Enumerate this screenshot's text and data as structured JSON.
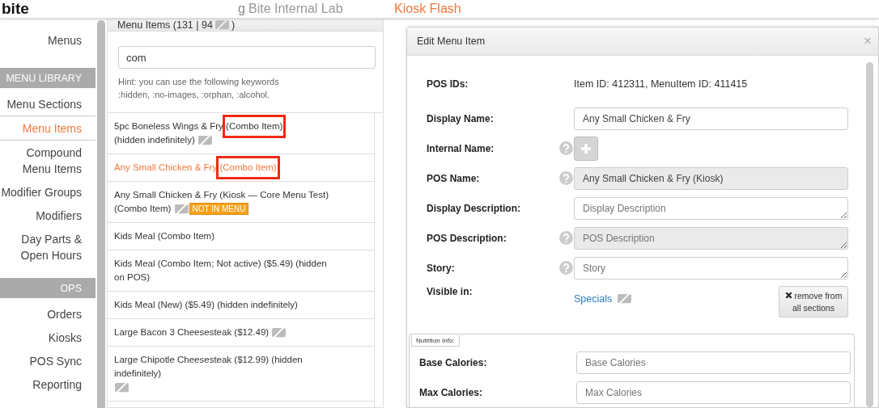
{
  "header": {
    "logo": "bite",
    "nav": [
      "g",
      "Bite Internal Lab",
      "Kiosk Flash"
    ]
  },
  "sidebar": {
    "items": [
      {
        "kind": "link",
        "label": "Menus",
        "selected": false
      },
      {
        "kind": "heading",
        "label": "MENU LIBRARY"
      },
      {
        "kind": "link",
        "label": "Menu Sections",
        "selected": false
      },
      {
        "kind": "link",
        "label": "Menu Items",
        "selected": true
      },
      {
        "kind": "link",
        "label": "Compound Menu Items",
        "selected": false
      },
      {
        "kind": "link",
        "label": "Modifier Groups",
        "selected": false
      },
      {
        "kind": "link",
        "label": "Modifiers",
        "selected": false
      },
      {
        "kind": "link",
        "label": "Day Parts & Open Hours",
        "selected": false
      },
      {
        "kind": "heading",
        "label": "OPS"
      },
      {
        "kind": "link",
        "label": "Orders",
        "selected": false
      },
      {
        "kind": "link",
        "label": "Kiosks",
        "selected": false
      },
      {
        "kind": "link",
        "label": "POS Sync",
        "selected": false
      },
      {
        "kind": "link",
        "label": "Reporting",
        "selected": false
      }
    ]
  },
  "list_panel": {
    "title_start": "Menu Items (131 | 94",
    "title_end": ")",
    "search": {
      "value": "com"
    },
    "hint": "Hint: you can use the following keywords :hidden, :no-images, :orphan, :alcohol.",
    "items": [
      {
        "selected": false,
        "parts": [
          {
            "text": "5pc Boneless Wings & Fry",
            "highlighted": false
          },
          {
            "text": "(Combo Item)",
            "highlighted": true
          },
          {
            "text": "(hidden indefinitely)",
            "highlighted": false
          }
        ],
        "hidden_icon": true
      },
      {
        "selected": true,
        "parts": [
          {
            "text": "Any Small Chicken & Fry",
            "highlighted": false
          },
          {
            "text": "(Combo Item)",
            "highlighted": true
          }
        ],
        "hidden_icon": false
      },
      {
        "selected": false,
        "parts": [
          {
            "text": "Any Small Chicken & Fry (Kiosk — Core Menu Test)",
            "highlighted": false
          },
          {
            "text": "(Combo Item)",
            "highlighted": false
          }
        ],
        "hidden_icon": true,
        "badge": "NOT IN MENU"
      },
      {
        "selected": false,
        "parts": [
          {
            "text": "Kids Meal (Combo Item)",
            "highlighted": false
          }
        ],
        "hidden_icon": false
      },
      {
        "selected": false,
        "parts": [
          {
            "text": "Kids Meal (Combo Item; Not active) ($5.49) (hidden on POS)",
            "highlighted": false
          }
        ],
        "hidden_icon": false
      },
      {
        "selected": false,
        "parts": [
          {
            "text": "Kids Meal (New) ($5.49) (hidden indefinitely)",
            "highlighted": false
          }
        ],
        "hidden_icon": false
      },
      {
        "selected": false,
        "parts": [
          {
            "text": "Large Bacon 3 Cheesesteak ($12.49)",
            "highlighted": false
          }
        ],
        "hidden_icon": true
      },
      {
        "selected": false,
        "parts": [
          {
            "text": "Large Chipotle Cheesesteak ($12.99) (hidden indefinitely)",
            "highlighted": false
          }
        ],
        "hidden_icon": true
      }
    ]
  },
  "modal": {
    "title": "Edit Menu Item",
    "close": "×",
    "rows": [
      {
        "kind": "text",
        "label": "POS IDs:",
        "help": false,
        "value": "Item ID: 412311, MenuItem ID: 411415"
      },
      {
        "kind": "input",
        "label": "Display Name:",
        "help": false,
        "value": "Any Small Chicken & Fry",
        "disabled": false
      },
      {
        "kind": "add",
        "label": "Internal Name:",
        "help": true
      },
      {
        "kind": "input",
        "label": "POS Name:",
        "help": true,
        "value": "Any Small Chicken & Fry (Kiosk)",
        "disabled": true
      },
      {
        "kind": "textarea",
        "label": "Display Description:",
        "help": false,
        "placeholder": "Display Description",
        "disabled": false
      },
      {
        "kind": "textarea",
        "label": "POS Description:",
        "help": true,
        "placeholder": "POS Description",
        "disabled": true
      },
      {
        "kind": "textarea",
        "label": "Story:",
        "help": true,
        "placeholder": "Story",
        "disabled": false
      },
      {
        "kind": "visible",
        "label": "Visible in:",
        "help": false,
        "link": "Specials",
        "button": "remove from all sections"
      }
    ],
    "nutrition": {
      "legend": "Nutrition Info:",
      "rows": [
        {
          "label": "Base Calories:",
          "placeholder": "Base Calories"
        },
        {
          "label": "Max Calories:",
          "placeholder": "Max Calories"
        }
      ]
    }
  }
}
